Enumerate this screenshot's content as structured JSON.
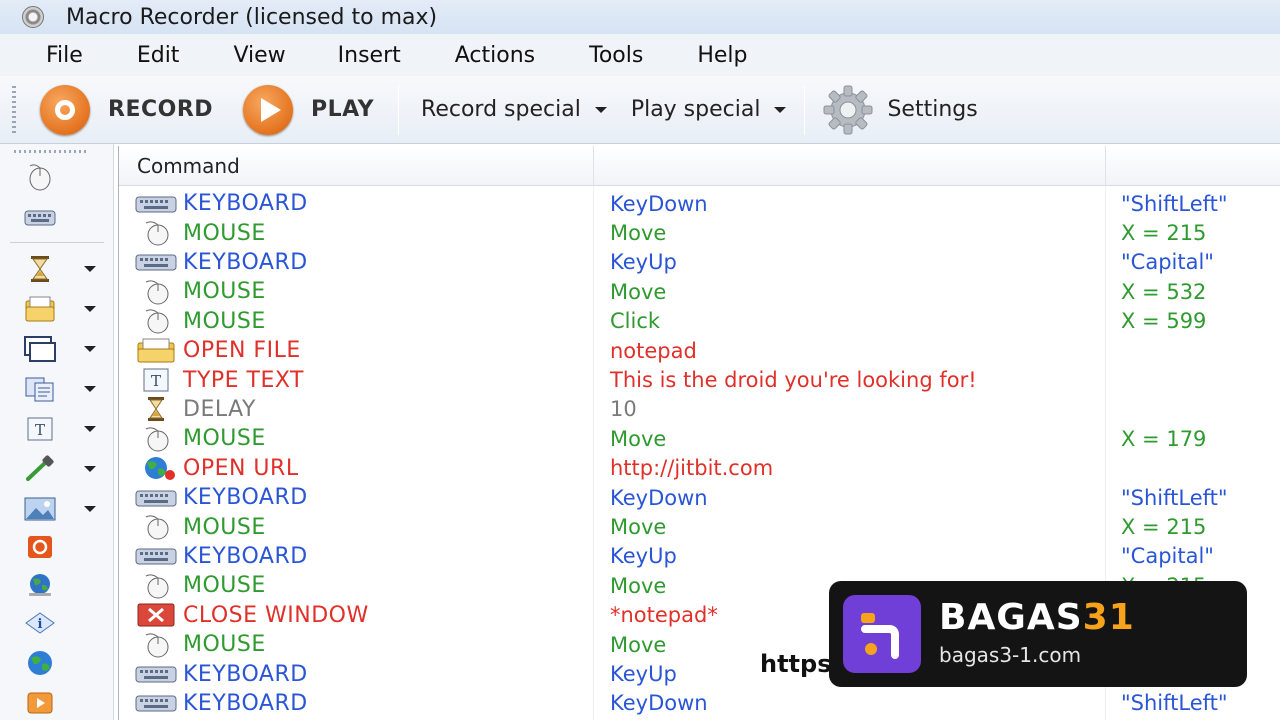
{
  "window": {
    "title": "Macro Recorder (licensed to max)"
  },
  "menu": [
    "File",
    "Edit",
    "View",
    "Insert",
    "Actions",
    "Tools",
    "Help"
  ],
  "toolbar": {
    "record_label": "RECORD",
    "play_label": "PLAY",
    "record_special_label": "Record special",
    "play_special_label": "Play special",
    "settings_label": "Settings"
  },
  "palette": [
    {
      "icon": "mouse-icon",
      "has_dropdown": false
    },
    {
      "icon": "keyboard-icon",
      "has_dropdown": false
    },
    {
      "icon": "hourglass-icon",
      "has_dropdown": true
    },
    {
      "icon": "open-file-icon",
      "has_dropdown": true
    },
    {
      "icon": "window-icon",
      "has_dropdown": true
    },
    {
      "icon": "copy-icon",
      "has_dropdown": true
    },
    {
      "icon": "type-text-icon",
      "has_dropdown": true
    },
    {
      "icon": "eyedropper-icon",
      "has_dropdown": true
    },
    {
      "icon": "image-icon",
      "has_dropdown": true
    },
    {
      "icon": "stop-icon",
      "has_dropdown": false
    },
    {
      "icon": "globe-icon",
      "has_dropdown": false
    },
    {
      "icon": "info-icon",
      "has_dropdown": false
    },
    {
      "icon": "open-url-icon",
      "has_dropdown": false
    },
    {
      "icon": "play-macro-icon",
      "has_dropdown": false
    }
  ],
  "grid": {
    "headers": [
      "Command",
      "",
      ""
    ],
    "colors": {
      "keyboard": "#2a55d6",
      "mouse": "#2f9a2f",
      "red": "#e0302a",
      "delay": "#7a7a7a"
    },
    "rows": [
      {
        "kind": "keyboard",
        "icon": "keyboard-icon",
        "command": "KEYBOARD",
        "action": "KeyDown",
        "value": "\"ShiftLeft\""
      },
      {
        "kind": "mouse",
        "icon": "mouse-icon",
        "command": "MOUSE",
        "action": "Move",
        "value": "X = 215"
      },
      {
        "kind": "keyboard",
        "icon": "keyboard-icon",
        "command": "KEYBOARD",
        "action": "KeyUp",
        "value": "\"Capital\""
      },
      {
        "kind": "mouse",
        "icon": "mouse-icon",
        "command": "MOUSE",
        "action": "Move",
        "value": "X = 532"
      },
      {
        "kind": "mouse",
        "icon": "mouse-icon",
        "command": "MOUSE",
        "action": "Click",
        "value": "X = 599"
      },
      {
        "kind": "red",
        "icon": "open-file-icon",
        "command": "OPEN FILE",
        "action": "notepad",
        "value": ""
      },
      {
        "kind": "red",
        "icon": "type-text-icon",
        "command": "TYPE TEXT",
        "action": "This is the droid you're looking for!",
        "value": ""
      },
      {
        "kind": "delay",
        "icon": "hourglass-icon",
        "command": "DELAY",
        "action": "10",
        "value": ""
      },
      {
        "kind": "mouse",
        "icon": "mouse-icon",
        "command": "MOUSE",
        "action": "Move",
        "value": "X = 179"
      },
      {
        "kind": "red",
        "icon": "globe-icon",
        "command": "OPEN URL",
        "action": "http://jitbit.com",
        "value": ""
      },
      {
        "kind": "keyboard",
        "icon": "keyboard-icon",
        "command": "KEYBOARD",
        "action": "KeyDown",
        "value": "\"ShiftLeft\""
      },
      {
        "kind": "mouse",
        "icon": "mouse-icon",
        "command": "MOUSE",
        "action": "Move",
        "value": "X = 215"
      },
      {
        "kind": "keyboard",
        "icon": "keyboard-icon",
        "command": "KEYBOARD",
        "action": "KeyUp",
        "value": "\"Capital\""
      },
      {
        "kind": "mouse",
        "icon": "mouse-icon",
        "command": "MOUSE",
        "action": "Move",
        "value": "X = 215"
      },
      {
        "kind": "red",
        "icon": "close-window-icon",
        "command": "CLOSE WINDOW",
        "action": "*notepad*",
        "value": ""
      },
      {
        "kind": "mouse",
        "icon": "mouse-icon",
        "command": "MOUSE",
        "action": "Move",
        "value": ""
      },
      {
        "kind": "keyboard",
        "icon": "keyboard-icon",
        "command": "KEYBOARD",
        "action": "KeyUp",
        "value": ""
      },
      {
        "kind": "keyboard",
        "icon": "keyboard-icon",
        "command": "KEYBOARD",
        "action": "KeyDown",
        "value": "\"ShiftLeft\""
      }
    ]
  },
  "watermark": {
    "url_text": "https",
    "brand_main": "BAGAS",
    "brand_accent": "31",
    "brand_accent_color": "#f7a21b",
    "domain": "bagas3-1.com"
  }
}
